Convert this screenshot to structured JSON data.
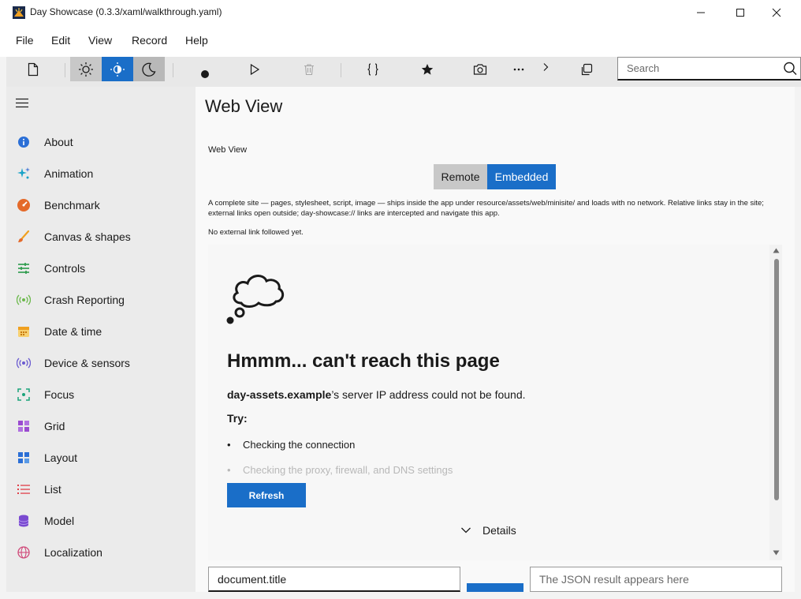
{
  "window": {
    "title": "Day Showcase (0.3.3/xaml/walkthrough.yaml)",
    "controls": [
      "minimize-icon",
      "maximize-icon",
      "close-icon"
    ]
  },
  "menu": [
    "File",
    "Edit",
    "View",
    "Record",
    "Help"
  ],
  "toolbar": {
    "icons": [
      "new-page-icon",
      "sun-icon",
      "contrast-icon",
      "moon-icon",
      "record-dot-icon",
      "play-icon",
      "trash-icon",
      "braces-icon",
      "star-icon",
      "camera-icon",
      "more-icon",
      "chevron-right-icon",
      "copy-icon"
    ],
    "accent": "#1a6ec8"
  },
  "search": {
    "placeholder": "Search"
  },
  "sidebar": {
    "items": [
      {
        "label": "About",
        "icon": "info-icon",
        "color": "#2b6fd6"
      },
      {
        "label": "Animation",
        "icon": "sparkle-icon",
        "color": "#1aa3c8"
      },
      {
        "label": "Benchmark",
        "icon": "gauge-icon",
        "color": "#e46a2a"
      },
      {
        "label": "Canvas & shapes",
        "icon": "brush-icon",
        "color": "#f0a020"
      },
      {
        "label": "Controls",
        "icon": "sliders-icon",
        "color": "#2a9a4a"
      },
      {
        "label": "Crash Reporting",
        "icon": "broadcast-icon",
        "color": "#6ab84a"
      },
      {
        "label": "Date & time",
        "icon": "calendar-icon",
        "color": "#f0b020"
      },
      {
        "label": "Device & sensors",
        "icon": "sensor-icon",
        "color": "#6a5ad0"
      },
      {
        "label": "Focus",
        "icon": "focus-icon",
        "color": "#1aa37a"
      },
      {
        "label": "Grid",
        "icon": "grid-icon",
        "color": "#9a4ad0"
      },
      {
        "label": "Layout",
        "icon": "layout-icon",
        "color": "#2b6fd6"
      },
      {
        "label": "List",
        "icon": "list-icon",
        "color": "#e0404a"
      },
      {
        "label": "Model",
        "icon": "database-icon",
        "color": "#7a4ad0"
      },
      {
        "label": "Localization",
        "icon": "globe-icon",
        "color": "#d04a7a"
      }
    ]
  },
  "main": {
    "title": "Web View",
    "section_label": "Web View",
    "segments": [
      {
        "label": "Remote",
        "selected": false
      },
      {
        "label": "Embedded",
        "selected": true
      }
    ],
    "description": "A complete site — pages, stylesheet, script, image — ships inside the app under resource/assets/web/minisite/ and loads with no network. Relative links stay in the site; external links open outside; day-showcase:// links are intercepted and navigate this app.",
    "status": "No external link followed yet.",
    "webview": {
      "error_title": "Hmmm... can't reach this page",
      "host": "day-assets.example",
      "host_suffix": "’s server IP address could not be found.",
      "try_label": "Try:",
      "suggestions": [
        "Checking the connection",
        "Checking the proxy, firewall, and DNS settings"
      ],
      "refresh_label": "Refresh",
      "details_label": "Details"
    },
    "expression_value": "document.title",
    "result_placeholder": "The JSON result appears here"
  }
}
